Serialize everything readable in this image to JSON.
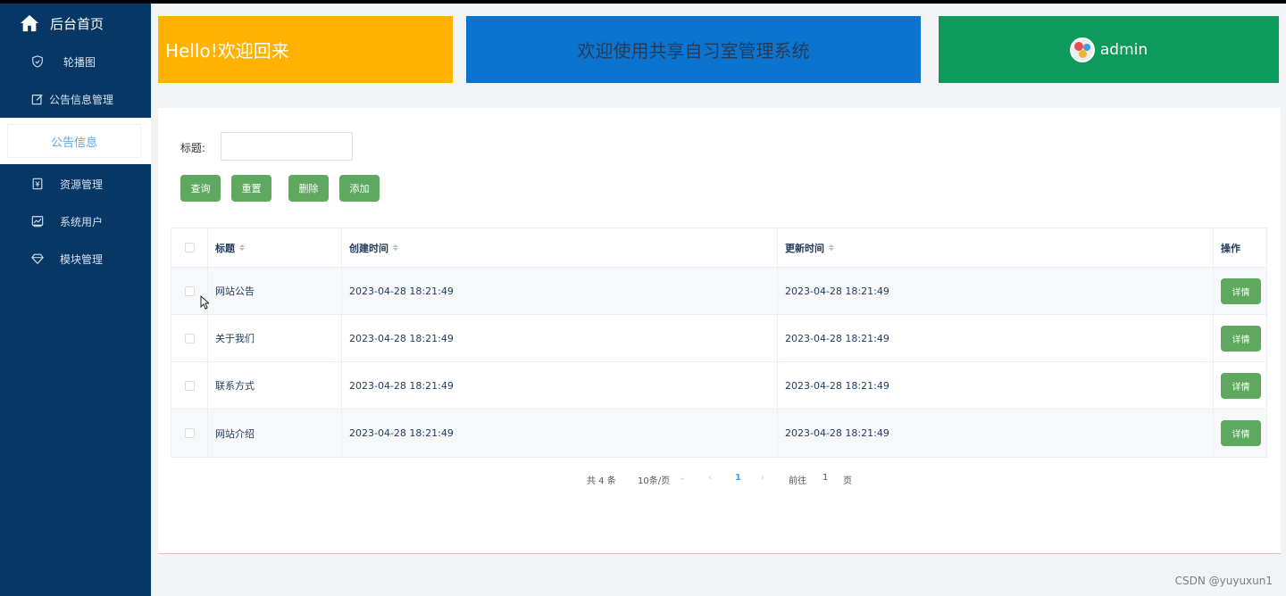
{
  "sidebar": {
    "brand": "后台首页",
    "items": [
      {
        "label": "轮播图",
        "icon": "shield-icon"
      },
      {
        "label": "公告信息管理",
        "icon": "edit-icon"
      },
      {
        "label": "公告信息",
        "icon": ""
      },
      {
        "label": "资源管理",
        "icon": "document-icon"
      },
      {
        "label": "系统用户",
        "icon": "chart-icon"
      },
      {
        "label": "模块管理",
        "icon": "diamond-icon"
      }
    ]
  },
  "header": {
    "greeting": "Hello!欢迎回来",
    "system_title": "欢迎使用共享自习室管理系统",
    "username": "admin"
  },
  "search": {
    "label": "标题:",
    "value": "",
    "placeholder": ""
  },
  "buttons": {
    "query": "查询",
    "reset": "重置",
    "delete": "删除",
    "add": "添加"
  },
  "table": {
    "columns": [
      "标题",
      "创建时间",
      "更新时间",
      "操作"
    ],
    "rows": [
      {
        "title": "网站公告",
        "created": "2023-04-28 18:21:49",
        "updated": "2023-04-28 18:21:49",
        "action": "详情"
      },
      {
        "title": "关于我们",
        "created": "2023-04-28 18:21:49",
        "updated": "2023-04-28 18:21:49",
        "action": "详情"
      },
      {
        "title": "联系方式",
        "created": "2023-04-28 18:21:49",
        "updated": "2023-04-28 18:21:49",
        "action": "详情"
      },
      {
        "title": "网站介绍",
        "created": "2023-04-28 18:21:49",
        "updated": "2023-04-28 18:21:49",
        "action": "详情"
      }
    ]
  },
  "pagination": {
    "total": "共 4 条",
    "page_size": "10条/页",
    "current_page": "1",
    "goto_label": "前往",
    "goto_value": "1",
    "page_suffix": "页"
  },
  "watermark": "CSDN @yuyuxun1",
  "colors": {
    "sidebar": "#073764",
    "banner_yellow": "#ffb300",
    "banner_blue": "#0b74ce",
    "banner_green": "#0e9a5a",
    "button_green": "#5fa85f"
  }
}
